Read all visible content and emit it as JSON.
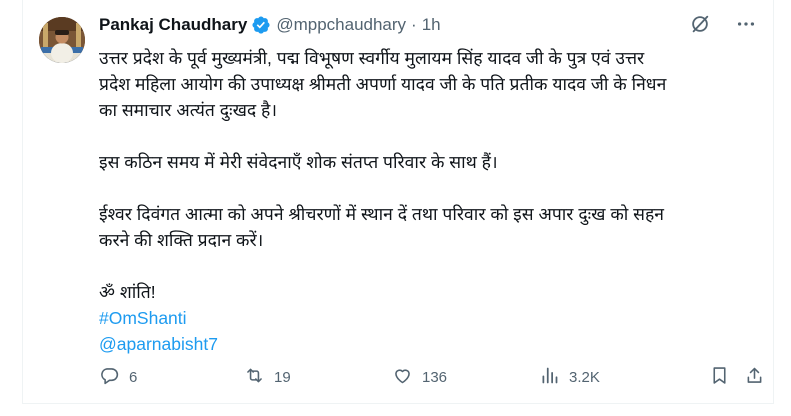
{
  "author": {
    "name": "Pankaj Chaudhary",
    "handle": "@mppchaudhary",
    "separator": "·",
    "time": "1h",
    "verified_color": "#1d9bf0"
  },
  "tweet": {
    "para1": [
      "उत्तर प्रदेश के पूर्व मुख्यमंत्री, पद्म विभूषण स्वर्गीय मुलायम सिंह यादव जी के पुत्र एवं उत्तर",
      "प्रदेश महिला आयोग की उपाध्यक्ष श्रीमती अपर्णा यादव जी के पति प्रतीक यादव जी के निधन",
      "का समाचार अत्यंत दुःखद है।"
    ],
    "para2": [
      "इस कठिन समय में मेरी संवेदनाएँ शोक संतप्त परिवार के साथ हैं।"
    ],
    "para3": [
      "ईश्वर दिवंगत आत्मा को अपने श्रीचरणों में स्थान दें तथा परिवार को इस अपार दुःख को सहन",
      "करने की शक्ति प्रदान करें।"
    ],
    "closing": "ॐ शांति!",
    "hashtag": "#OmShanti",
    "mention": "@aparnabisht7"
  },
  "actions": {
    "replies": "6",
    "reposts": "19",
    "likes": "136",
    "views": "3.2K"
  },
  "colors": {
    "link": "#1d9bf0",
    "muted": "#536471",
    "text": "#0f1419"
  },
  "icons": [
    "verified-badge-icon",
    "grok-icon",
    "more-icon",
    "reply-icon",
    "repost-icon",
    "like-icon",
    "views-icon",
    "bookmark-icon",
    "share-icon"
  ]
}
